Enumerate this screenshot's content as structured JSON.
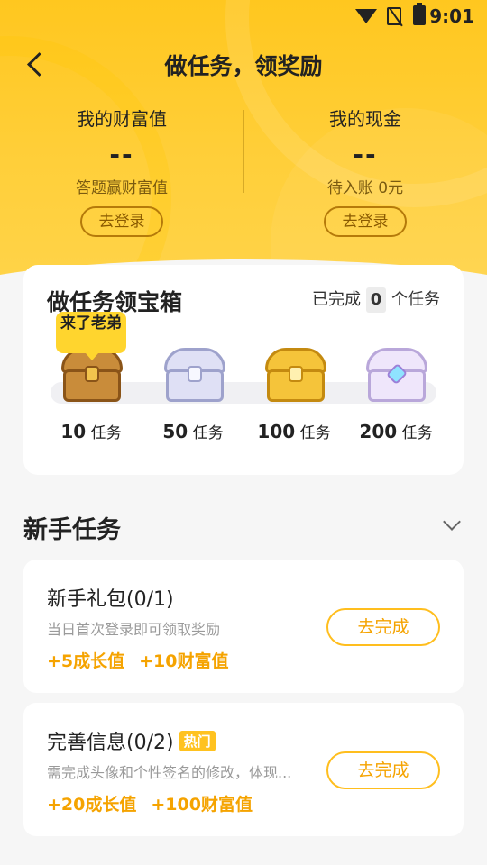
{
  "status": {
    "time": "9:01"
  },
  "header": {
    "title": "做任务，领奖励"
  },
  "wealth": {
    "label": "我的财富值",
    "value": "--",
    "sub": "答题赢财富值",
    "login": "去登录"
  },
  "cash": {
    "label": "我的现金",
    "value": "--",
    "sub": "待入账 0元",
    "login": "去登录"
  },
  "treasure": {
    "title": "做任务领宝箱",
    "done_prefix": "已完成",
    "done_count": "0",
    "done_suffix": "个任务",
    "tip": "来了老弟",
    "tiers": [
      {
        "num": "10",
        "unit": "任务"
      },
      {
        "num": "50",
        "unit": "任务"
      },
      {
        "num": "100",
        "unit": "任务"
      },
      {
        "num": "200",
        "unit": "任务"
      }
    ]
  },
  "section": {
    "title": "新手任务"
  },
  "tasks": [
    {
      "name": "新手礼包(0/1)",
      "desc": "当日首次登录即可领取奖励",
      "reward1": "+5成长值",
      "reward2": "+10财富值",
      "button": "去完成"
    },
    {
      "name": "完善信息(0/2)",
      "badge": "热门",
      "desc": "需完成头像和个性签名的修改，体现...",
      "reward1": "+20成长值",
      "reward2": "+100财富值",
      "button": "去完成"
    }
  ]
}
